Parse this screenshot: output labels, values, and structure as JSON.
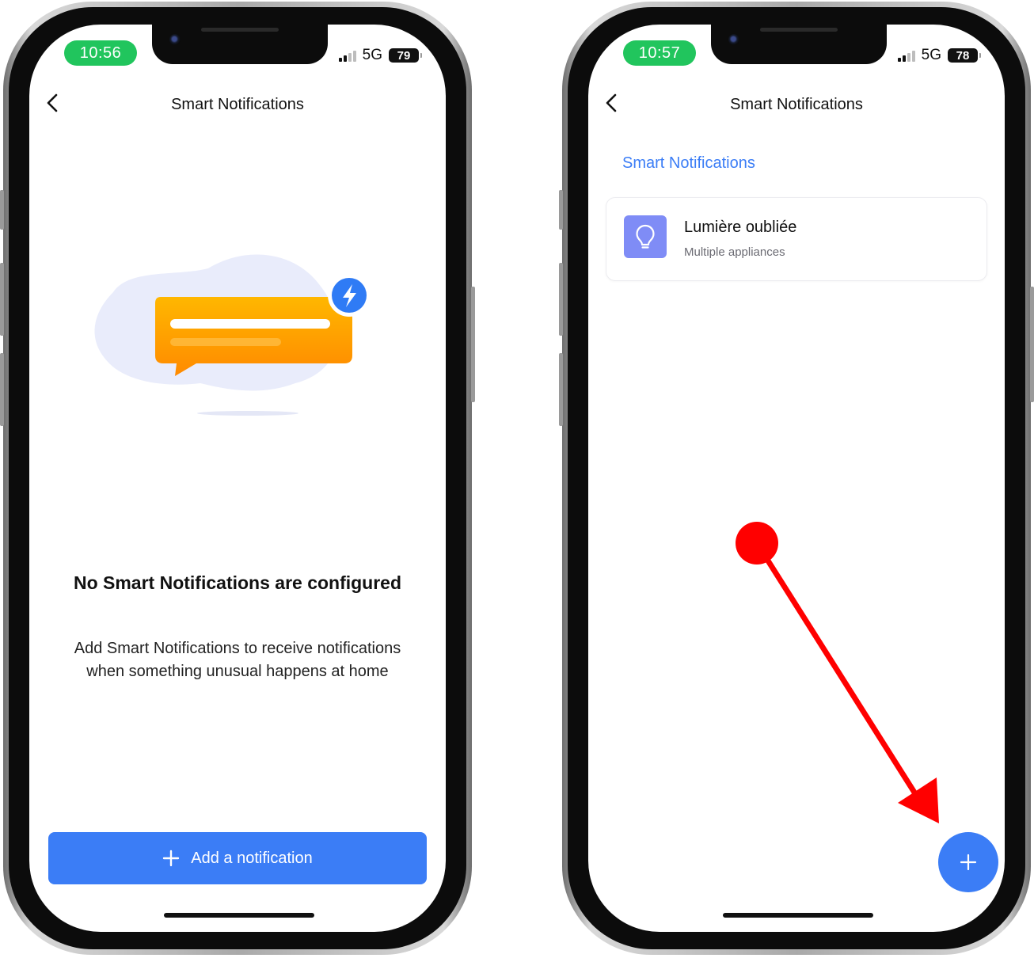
{
  "colors": {
    "accent": "#3b7df6",
    "time_pill": "#21c55d",
    "rule_icon_bg": "#7f8cf6",
    "annotation_red": "#ff0000",
    "illustration_bubble": "#ffa20a",
    "illustration_badge": "#2f7bf5"
  },
  "left_phone": {
    "status_bar": {
      "time": "10:56",
      "network": "5G",
      "battery": "79"
    },
    "nav": {
      "back_icon": "chevron-left-icon",
      "title": "Smart Notifications"
    },
    "empty_state": {
      "illustration_icon": "chat-bubble-lightning-illustration",
      "title": "No Smart Notifications are configured",
      "description_line1": "Add Smart Notifications to receive notifications",
      "description_line2": "when something unusual happens at home"
    },
    "add_button": {
      "icon": "plus-icon",
      "label": "Add a notification"
    }
  },
  "right_phone": {
    "status_bar": {
      "time": "10:57",
      "network": "5G",
      "battery": "78"
    },
    "nav": {
      "back_icon": "chevron-left-icon",
      "title": "Smart Notifications"
    },
    "section_label": "Smart Notifications",
    "rules": [
      {
        "icon": "lightbulb-icon",
        "title": "Lumière oubliée",
        "subtitle": "Multiple appliances"
      }
    ],
    "fab": {
      "icon": "plus-icon"
    }
  },
  "annotation": {
    "type": "red-arrow",
    "points_to": "add-fab-button"
  }
}
